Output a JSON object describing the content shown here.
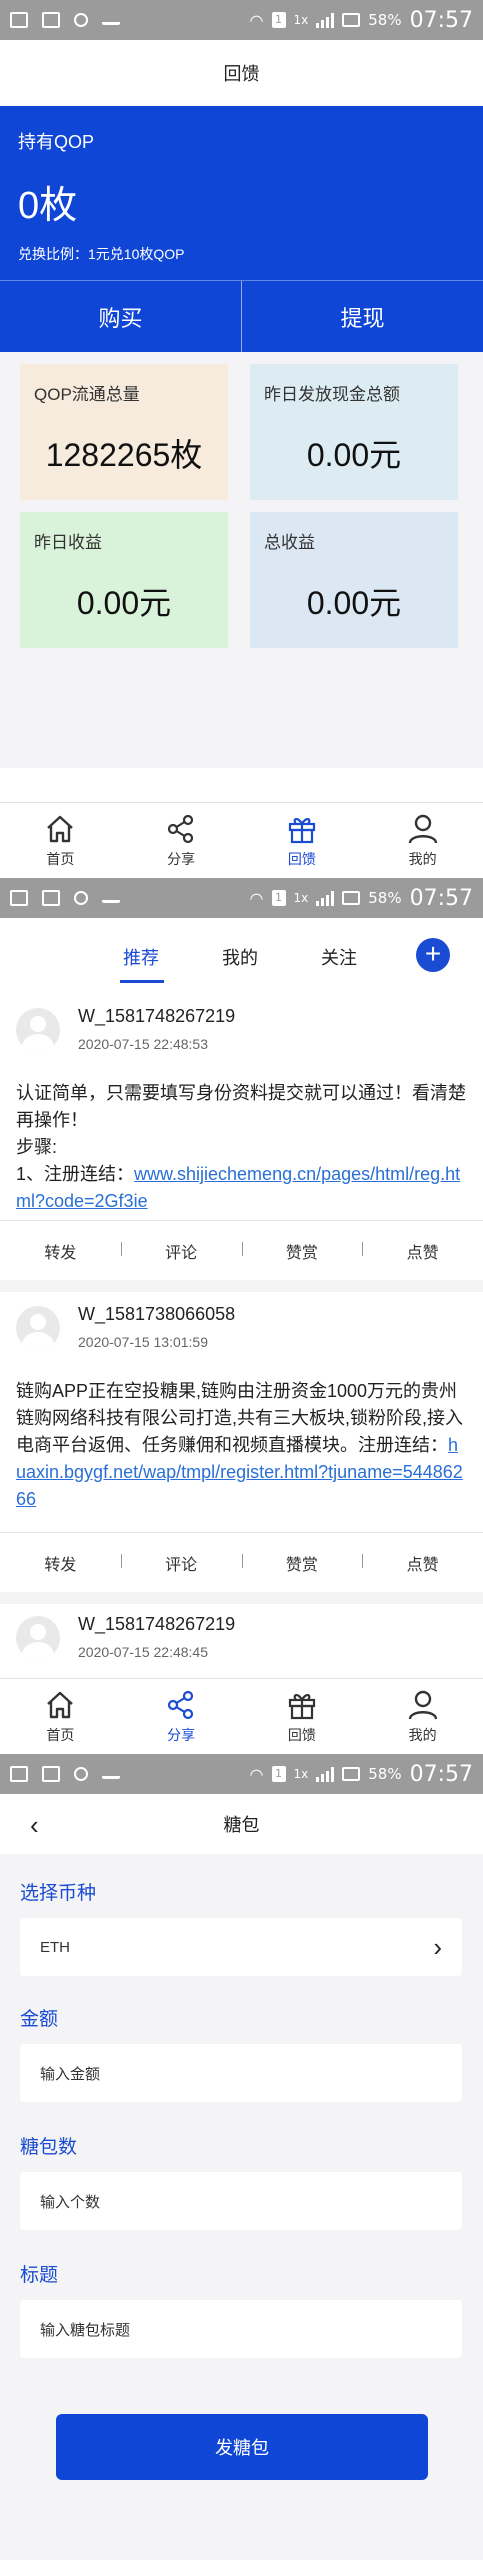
{
  "status_bar": {
    "battery": "58%",
    "time": "07:57",
    "network": "1x",
    "sim": "1"
  },
  "screen1": {
    "title": "回馈",
    "card": {
      "holding_label": "持有QOP",
      "amount": "0枚",
      "rate": "兑换比例：1元兑10枚QOP",
      "buy": "购买",
      "withdraw": "提现"
    },
    "stats": [
      {
        "label": "QOP流通总量",
        "value": "1282265枚"
      },
      {
        "label": "昨日发放现金总额",
        "value": "0.00元"
      },
      {
        "label": "昨日收益",
        "value": "0.00元"
      },
      {
        "label": "总收益",
        "value": "0.00元"
      }
    ],
    "active_tab": "回馈"
  },
  "tabbar": [
    {
      "label": "首页",
      "icon": "home-icon"
    },
    {
      "label": "分享",
      "icon": "share-icon"
    },
    {
      "label": "回馈",
      "icon": "gift-icon"
    },
    {
      "label": "我的",
      "icon": "user-icon"
    }
  ],
  "screen2": {
    "tabs": [
      "推荐",
      "我的",
      "关注"
    ],
    "active_tab": "分享",
    "posts": [
      {
        "user": "W_1581748267219",
        "time": "2020-07-15 22:48:53",
        "text": "认证简单，只需要填写身份资料提交就可以通过！看清楚再操作！",
        "text2": "步骤:",
        "text3": "1、注册连结：",
        "link": "www.shijiechemeng.cn/pages/html/reg.html?code=2Gf3ie"
      },
      {
        "user": "W_1581738066058",
        "time": "2020-07-15 13:01:59",
        "text": "链购APP正在空投糖果,链购由注册资金1000万元的贵州链购网络科技有限公司打造,共有三大板块,锁粉阶段,接入电商平台返佣、任务赚佣和视频直播模块。注册连结：",
        "link": "huaxin.bgygf.net/wap/tmpl/register.html?tjuname=54486266"
      },
      {
        "user": "W_1581748267219",
        "time": "2020-07-15 22:48:45"
      }
    ],
    "actions": [
      "转发",
      "评论",
      "赞赏",
      "点赞"
    ]
  },
  "screen3": {
    "title": "糖包",
    "coin_label": "选择币种",
    "coin_value": "ETH",
    "amount_label": "金额",
    "amount_placeholder": "输入金额",
    "count_label": "糖包数",
    "count_placeholder": "输入个数",
    "subject_label": "标题",
    "subject_placeholder": "输入糖包标题",
    "submit": "发糖包"
  },
  "colors": {
    "primary": "#0f46d6",
    "link": "#2a6fd6",
    "status_bar": "#9b9b9b"
  }
}
